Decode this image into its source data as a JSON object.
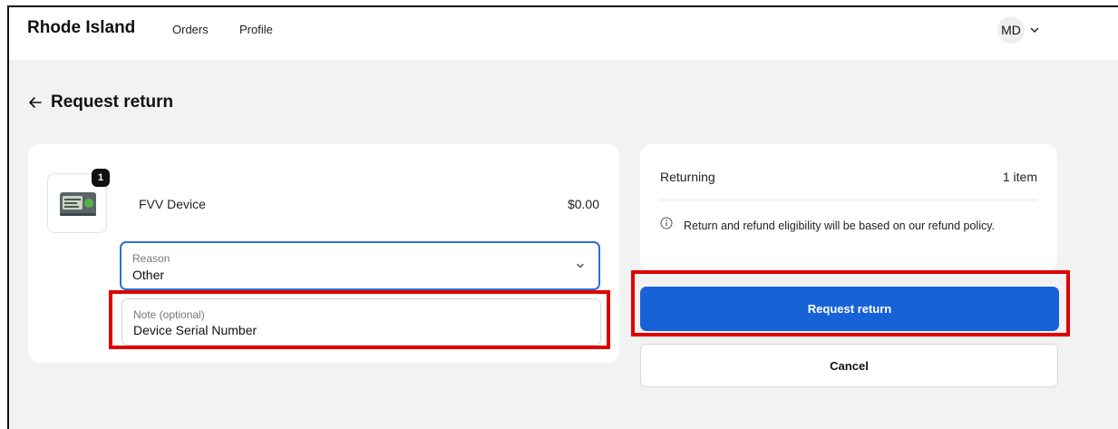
{
  "header": {
    "brand": "Rhode Island",
    "nav": [
      {
        "label": "Orders"
      },
      {
        "label": "Profile"
      }
    ],
    "account_initials": "MD"
  },
  "page": {
    "title": "Request return"
  },
  "item": {
    "quantity": "1",
    "name": "FVV Device",
    "price": "$0.00",
    "reason": {
      "label": "Reason",
      "value": "Other"
    },
    "note": {
      "label": "Note (optional)",
      "value": "Device Serial Number"
    }
  },
  "summary": {
    "returning_label": "Returning",
    "returning_count": "1 item",
    "info_text": "Return and refund eligibility will be based on our refund policy."
  },
  "actions": {
    "request_label": "Request return",
    "cancel_label": "Cancel"
  },
  "colors": {
    "primary": "#1862d8",
    "highlight": "#e00000",
    "focus": "#2b6fd6",
    "background": "#f2f2f2"
  },
  "icons": [
    "back-arrow-icon",
    "chevron-down-icon",
    "info-icon",
    "product-thumbnail"
  ]
}
